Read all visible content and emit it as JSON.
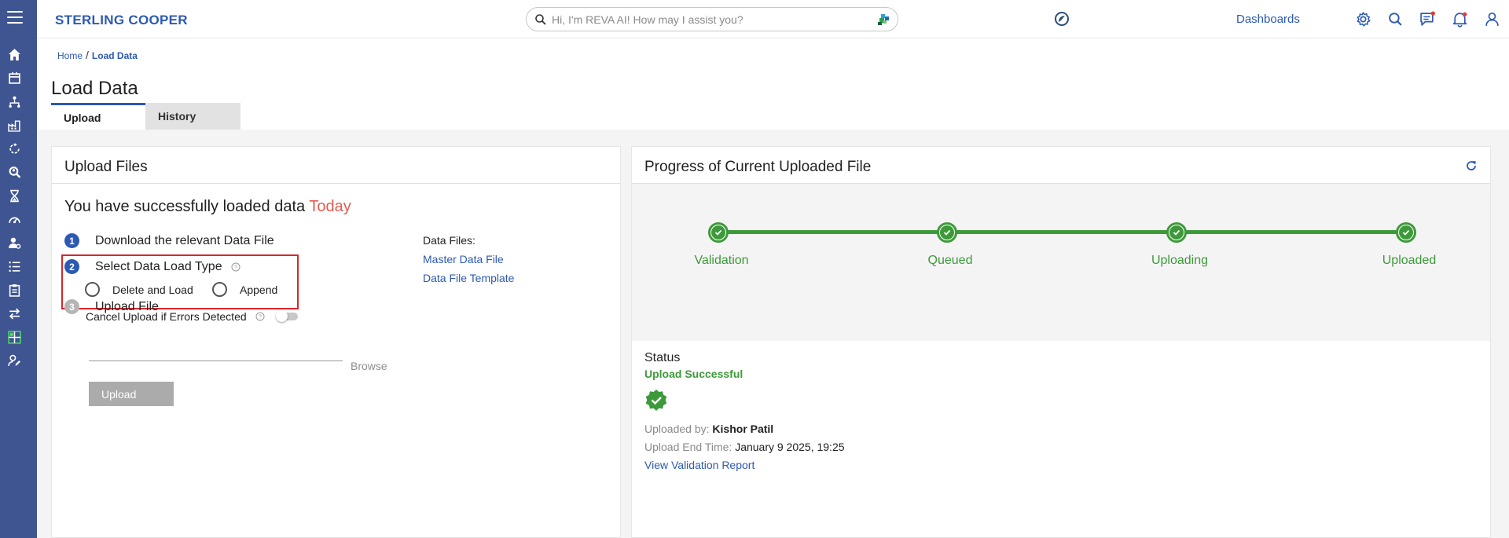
{
  "app": {
    "brand": "STERLING COOPER",
    "search_placeholder": "Hi, I'm REVA AI! How may I assist you?",
    "dashboards_label": "Dashboards"
  },
  "breadcrumb": {
    "home": "Home",
    "separator": "/",
    "current": "Load Data"
  },
  "page": {
    "title": "Load Data"
  },
  "tabs": [
    {
      "label": "Upload",
      "active": true
    },
    {
      "label": "History",
      "active": false
    }
  ],
  "upload_card": {
    "title": "Upload Files",
    "success_prefix": "You have successfully loaded data",
    "success_when": "Today",
    "steps": [
      {
        "number": "1",
        "label": "Download the relevant Data File"
      },
      {
        "number": "2",
        "label": "Select Data Load Type"
      },
      {
        "number": "3",
        "label": "Upload File"
      }
    ],
    "load_type_options": [
      {
        "label": "Delete and Load",
        "selected": false
      },
      {
        "label": "Append",
        "selected": false
      }
    ],
    "cancel_label": "Cancel Upload if Errors Detected",
    "cancel_enabled": false,
    "browse_label": "Browse",
    "upload_button": "Upload",
    "data_files_heading": "Data Files:",
    "data_files": [
      "Master Data File",
      "Data File Template"
    ]
  },
  "progress_card": {
    "title": "Progress of Current Uploaded File",
    "stages": [
      "Validation",
      "Queued",
      "Uploading",
      "Uploaded"
    ],
    "status_title": "Status",
    "status_value": "Upload Successful",
    "uploaded_by_label": "Uploaded by:",
    "uploaded_by": "Kishor Patil",
    "end_time_label": "Upload End Time:",
    "end_time": "January 9 2025, 19:25",
    "report_link": "View Validation Report"
  },
  "icons": {
    "sidebar": [
      "home-icon",
      "calendar-icon",
      "hierarchy-icon",
      "factory-icon",
      "refresh-cycle-icon",
      "search-people-icon",
      "hourglass-icon",
      "speedometer-icon",
      "user-settings-icon",
      "list-icon",
      "clipboard-icon",
      "transfer-icon",
      "grid-icon",
      "user-edit-icon"
    ],
    "header": [
      "settings-icon",
      "search-icon",
      "chat-icon",
      "notification-bell-icon",
      "user-icon"
    ]
  },
  "colors": {
    "accent": "#2c5ab3",
    "success": "#3d9a3a",
    "today": "#e25b52",
    "sidebar": "#3f5591",
    "highlight": "#d6262c"
  }
}
